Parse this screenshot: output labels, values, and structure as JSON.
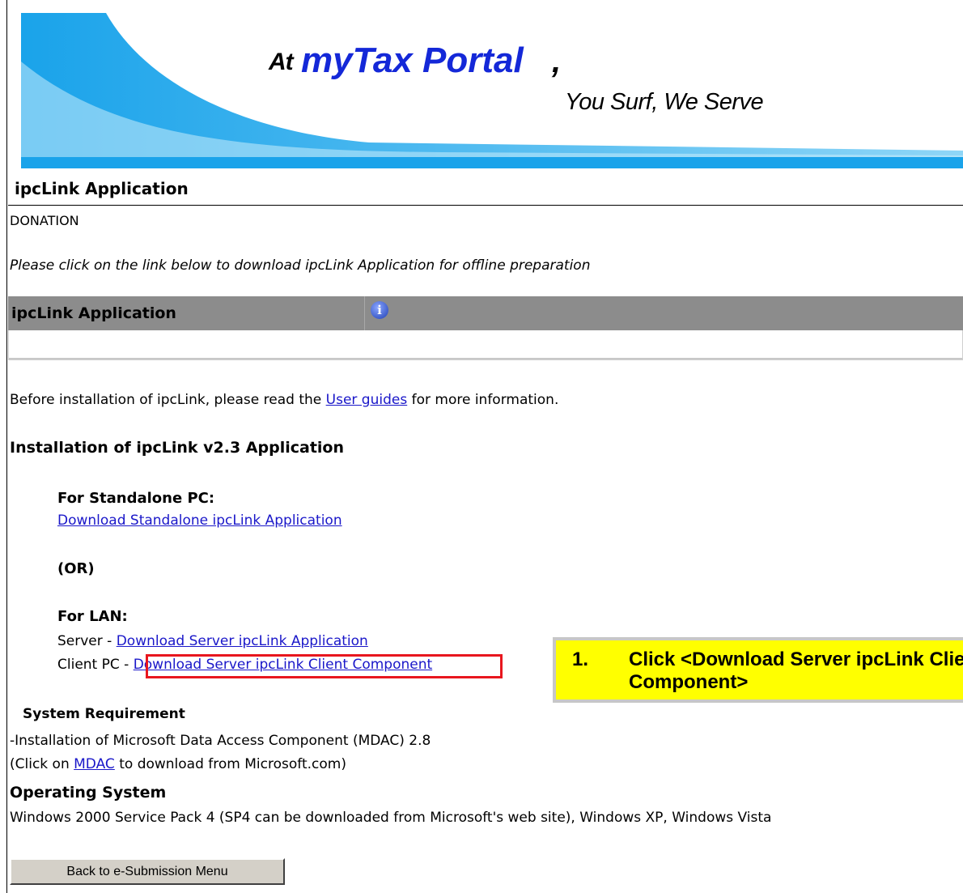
{
  "banner": {
    "at": "At",
    "brand": "myTax Portal",
    "comma": ",",
    "tagline": "You Surf, We Serve"
  },
  "page": {
    "title": "ipcLink Application",
    "category": "DONATION",
    "instruction": "Please click on the link below to download ipcLink Application for offline preparation"
  },
  "panel": {
    "header": "ipcLink Application",
    "info_icon": "info-icon"
  },
  "guides": {
    "before": "Before installation of ipcLink, please read the",
    "link": "User guides",
    "after": "for more information."
  },
  "install": {
    "heading": "Installation of ipcLink v2.3 Application",
    "standalone_heading": "For Standalone PC:",
    "standalone_link": "Download Standalone ipcLink Application",
    "or": "(OR)",
    "lan_heading": "For LAN:",
    "server_prefix": "Server -",
    "server_link": "Download Server ipcLink Application",
    "client_prefix": "Client PC -",
    "client_link": "Download Server ipcLink Client Component"
  },
  "callout": {
    "number": "1.",
    "line1": "Click <Download Server ipcLink Client",
    "line2": "Component>"
  },
  "requirements": {
    "heading": "System Requirement",
    "line1": "-Installation of Microsoft Data Access Component (MDAC) 2.8",
    "line2_before": "(Click on",
    "line2_link": "MDAC",
    "line2_after": "to download from Microsoft.com)",
    "os_heading": "Operating System",
    "os_text": "Windows 2000 Service Pack 4 (SP4 can be downloaded from Microsoft's web site), Windows XP, Windows Vista"
  },
  "buttons": {
    "back": "Back to e-Submission Menu"
  },
  "colors": {
    "link": "#1a17c9",
    "highlight_box": "#e8161e",
    "callout_bg": "#ffff00",
    "panel_header_bg": "#8c8c8c",
    "brand_blue": "#1428d8",
    "banner_sky": "#1aa3ea"
  }
}
